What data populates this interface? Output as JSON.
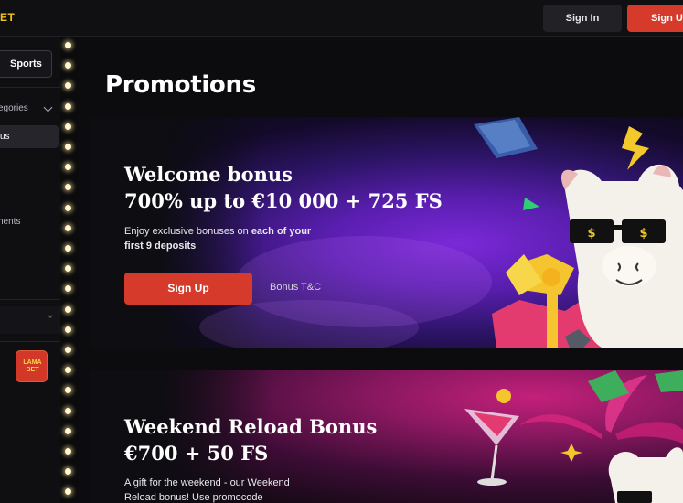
{
  "header": {
    "logo_text": "ET",
    "signin_label": "Sign In",
    "signup_label": "Sign Up"
  },
  "sidebar": {
    "sports_label": "Sports",
    "categories_label": "egories",
    "active_item_label": "us",
    "tournaments_label": "nents",
    "badge_line1": "LAMA",
    "badge_line2": "BET"
  },
  "main": {
    "page_title": "Promotions",
    "promos": [
      {
        "title_line1": "Welcome bonus",
        "title_line2": "700% up to €10 000 + 725 FS",
        "desc_part1": "Enjoy exclusive bonuses on ",
        "desc_bold1": "each of your",
        "desc_bold2": "first 9 deposits",
        "cta_label": "Sign Up",
        "link_label": "Bonus T&C"
      },
      {
        "title_line1": "Weekend Reload Bonus",
        "title_line2": "€700 + 50 FS",
        "desc_line1": "A gift for the weekend - our Weekend",
        "desc_line2": "Reload bonus! Use promocode"
      }
    ]
  },
  "colors": {
    "accent": "#d53a2a",
    "logo": "#f4c21f",
    "background": "#0c0c0e"
  }
}
